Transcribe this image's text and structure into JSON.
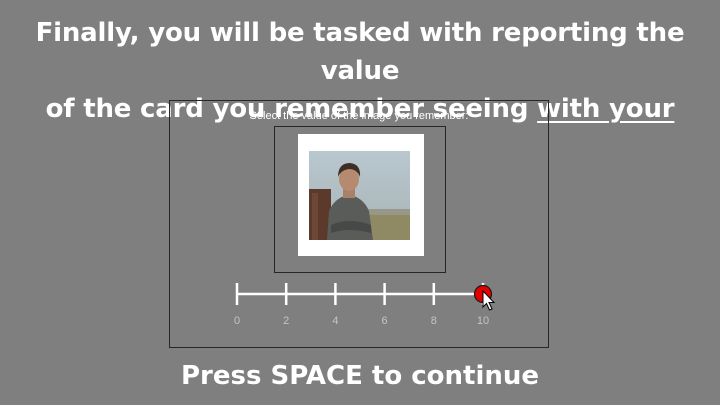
{
  "instructions": {
    "line1": "Finally, you will be tasked with reporting the value",
    "line2_prefix": "of the card you remember seeing ",
    "line2_emphasis": "with your mouse"
  },
  "task": {
    "prompt": "Select the value of the image you remember:",
    "image_description_icon": "portrait-photo",
    "slider": {
      "min": 0,
      "max": 10,
      "tick_labels": [
        "0",
        "2",
        "4",
        "6",
        "8",
        "10"
      ],
      "selected_value": 10,
      "handle_color": "#e00000",
      "track_color": "#ffffff",
      "tick_label_color": "#c4c4c4"
    }
  },
  "footer": {
    "continue_text": "Press SPACE to continue"
  },
  "colors": {
    "background": "#7f7f7f",
    "frame_border": "#262626",
    "text": "#ffffff"
  }
}
